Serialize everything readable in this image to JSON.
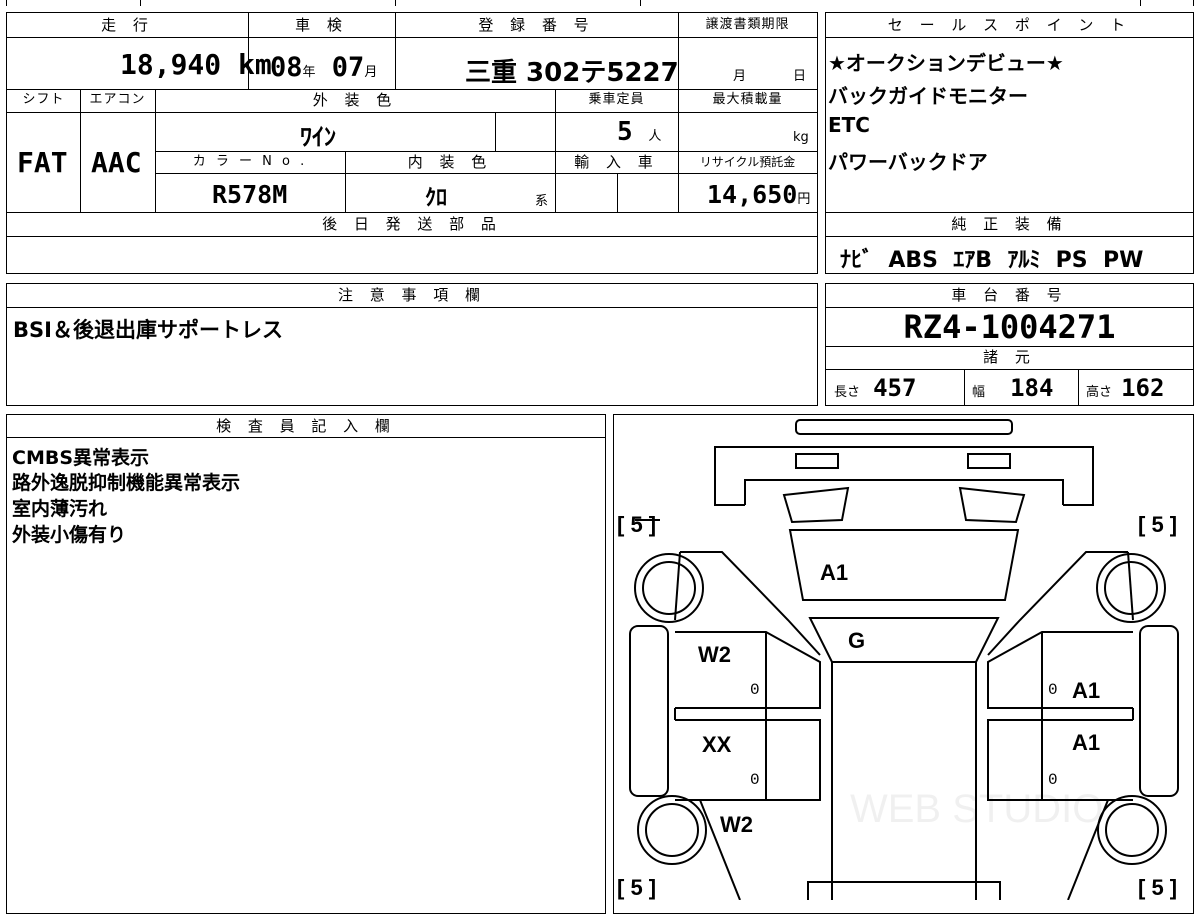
{
  "vehicle": {
    "mileage_label": "走 行",
    "mileage_value": "18,940",
    "mileage_unit": "km",
    "inspection_label": "車 検",
    "inspection_year": "08",
    "inspection_year_unit": "年",
    "inspection_month": "07",
    "inspection_month_unit": "月",
    "registration_label": "登 録 番 号",
    "registration_value": "三重 302テ5227",
    "transfer_deadline_label": "譲渡書類期限",
    "transfer_month_unit": "月",
    "transfer_day_unit": "日",
    "shift_label": "シフト",
    "shift_value": "FAT",
    "aircon_label": "エアコン",
    "aircon_value": "AAC",
    "exterior_color_label": "外 装 色",
    "exterior_color_value": "ﾜｲﾝ",
    "capacity_label": "乗車定員",
    "capacity_value": "5",
    "capacity_unit": "人",
    "max_load_label": "最大積載量",
    "max_load_unit": "kg",
    "color_no_label": "カ ラ ー N o .",
    "color_no_value": "R578M",
    "interior_color_label": "内 装 色",
    "interior_color_value": "ｸﾛ",
    "interior_color_suffix": "系",
    "import_label": "輸 入 車",
    "recycle_label": "リサイクル預託金",
    "recycle_value": "14,650",
    "recycle_unit": "円",
    "later_parts_label": "後 日 発 送 部 品"
  },
  "sales_points": {
    "label": "セ ー ル ス ポ イ ン ト",
    "lines": [
      "★オークションデビュー★",
      "バックガイドモニター",
      "ETC",
      "パワーバックドア"
    ]
  },
  "equipment": {
    "label": "純 正 装 備",
    "value": "ﾅﾋﾞ  ABS  ｴｱB  ｱﾙﾐ  PS  PW"
  },
  "notes": {
    "label": "注 意 事 項 欄",
    "text": "BSI＆後退出庫サポートレス"
  },
  "chassis": {
    "label": "車 台 番 号",
    "value": "RZ4-1004271",
    "specs_label": "諸 元",
    "length_label": "長さ",
    "length_value": "457",
    "width_label": "幅",
    "width_value": "184",
    "height_label": "高さ",
    "height_value": "162"
  },
  "inspector": {
    "label": "検 査 員 記 入 欄",
    "lines": [
      "CMBS異常表示",
      "路外逸脱抑制機能異常表示",
      "室内薄汚れ",
      "外装小傷有り"
    ]
  },
  "diagram": {
    "tire_fl": "[ 5 ]",
    "tire_fr": "[ 5 ]",
    "tire_rl": "[ 5 ]",
    "tire_rr": "[ 5 ]",
    "hood": "A1",
    "windshield": "G",
    "front_left_door": "W2",
    "front_right_door": "A1",
    "rear_left_door": "XX",
    "rear_right_door": "A1",
    "rear_left_fender": "W2",
    "zero_fl": "0",
    "zero_fr": "0",
    "zero_rl": "0",
    "zero_rr": "0",
    "watermark": "WEB STUDIO"
  }
}
